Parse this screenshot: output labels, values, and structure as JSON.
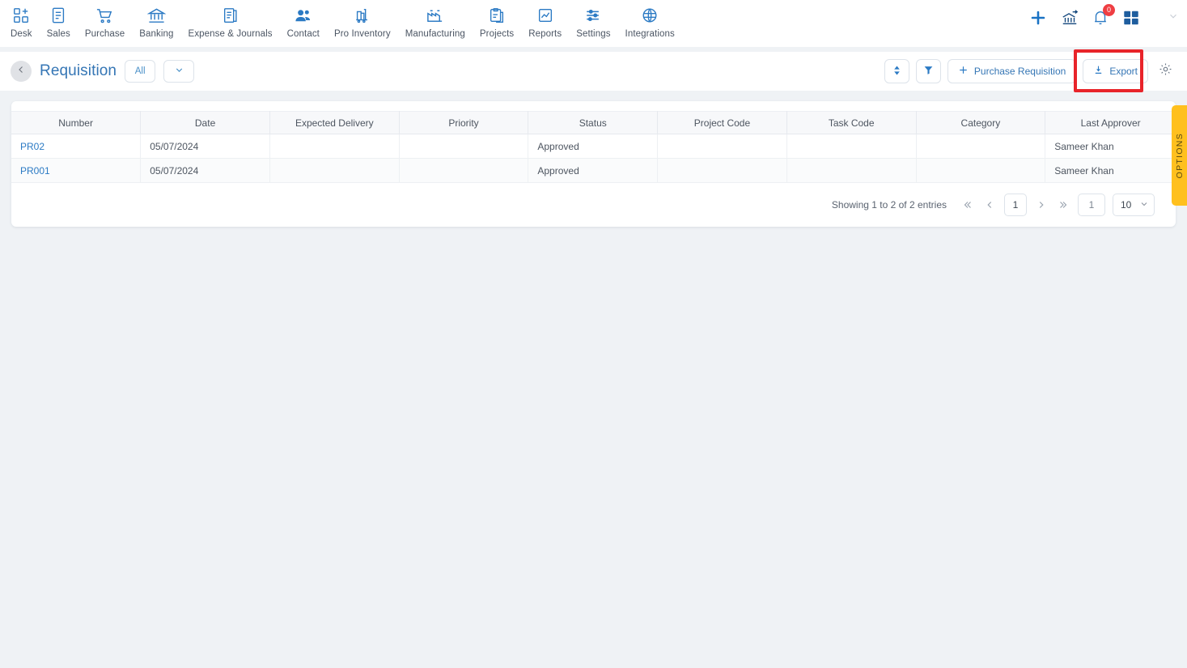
{
  "topnav": {
    "items": [
      {
        "label": "Desk",
        "icon": "desk-add-icon"
      },
      {
        "label": "Sales",
        "icon": "sales-document-icon"
      },
      {
        "label": "Purchase",
        "icon": "shopping-cart-icon"
      },
      {
        "label": "Banking",
        "icon": "bank-building-icon"
      },
      {
        "label": "Expense & Journals",
        "icon": "journal-book-icon"
      },
      {
        "label": "Contact",
        "icon": "contacts-people-icon"
      },
      {
        "label": "Pro Inventory",
        "icon": "inventory-forklift-icon"
      },
      {
        "label": "Manufacturing",
        "icon": "manufacturing-factory-icon"
      },
      {
        "label": "Projects",
        "icon": "projects-clipboard-icon"
      },
      {
        "label": "Reports",
        "icon": "reports-chart-icon"
      },
      {
        "label": "Settings",
        "icon": "settings-sliders-icon"
      },
      {
        "label": "Integrations",
        "icon": "integrations-globe-icon"
      }
    ],
    "actions": {
      "add": "plus-icon",
      "bank_transfer": "bank-transfer-icon",
      "notifications": "bell-icon",
      "notifications_count": "0",
      "apps": "grid-apps-icon",
      "profile_caret": "chevron-down-icon"
    }
  },
  "toolbar": {
    "back_icon": "chevron-left-icon",
    "title": "Requisition",
    "view_filter_label": "All",
    "view_dropdown_icon": "chevron-down-icon",
    "sort_icon": "sort-updown-icon",
    "filter_icon": "funnel-filter-icon",
    "new_label": "Purchase Requisition",
    "new_icon": "plus-icon",
    "export_label": "Export",
    "export_icon": "download-icon",
    "settings_icon": "gear-icon"
  },
  "table": {
    "columns": [
      "Number",
      "Date",
      "Expected Delivery",
      "Priority",
      "Status",
      "Project Code",
      "Task Code",
      "Category",
      "Last Approver"
    ],
    "rows": [
      {
        "number": "PR02",
        "date": "05/07/2024",
        "expected_delivery": "",
        "priority": "",
        "status": "Approved",
        "project_code": "",
        "task_code": "",
        "category": "",
        "last_approver": "Sameer Khan"
      },
      {
        "number": "PR001",
        "date": "05/07/2024",
        "expected_delivery": "",
        "priority": "",
        "status": "Approved",
        "project_code": "",
        "task_code": "",
        "category": "",
        "last_approver": "Sameer Khan"
      }
    ]
  },
  "pagination": {
    "info": "Showing 1 to 2 of 2 entries",
    "first_icon": "double-chevron-left-icon",
    "prev_icon": "chevron-left-icon",
    "current_page": "1",
    "next_icon": "chevron-right-icon",
    "last_icon": "double-chevron-right-icon",
    "goto_page": "1",
    "page_size": "10",
    "page_size_caret": "chevron-down-icon"
  },
  "options_tab": {
    "label": "OPTIONS"
  },
  "colors": {
    "page_background": "#eff2f5",
    "accent_blue": "#3576b5",
    "link_blue": "#2b7ac4",
    "highlight_red": "#e8242a",
    "badge_red": "#ef3e42",
    "options_yellow": "#ffc01e"
  }
}
